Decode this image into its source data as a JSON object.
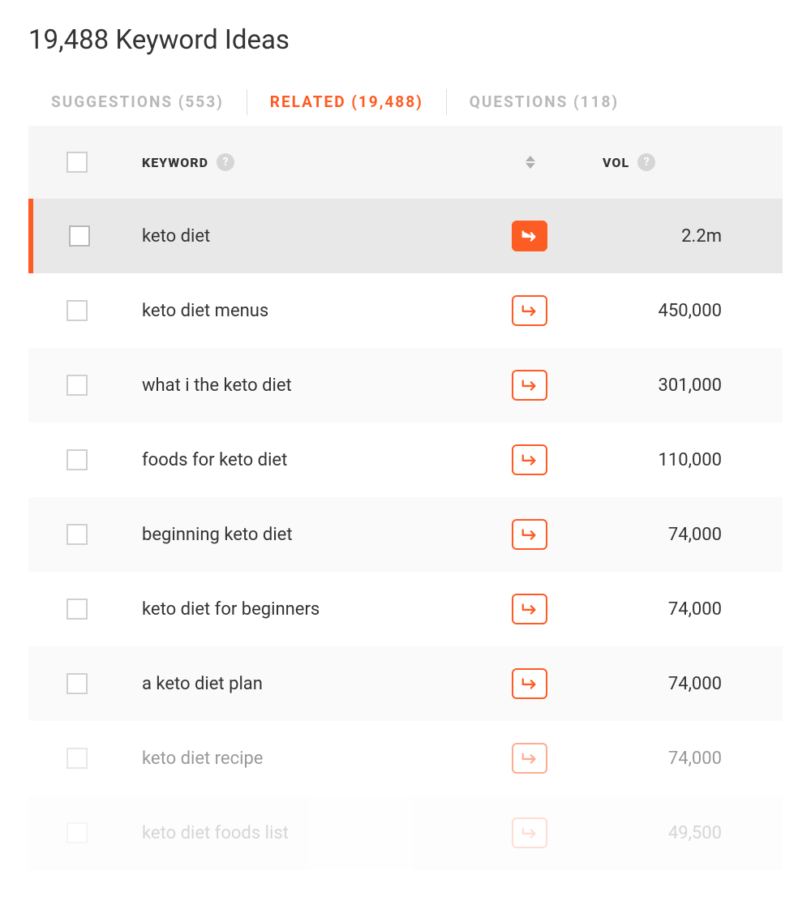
{
  "header": {
    "title": "19,488 Keyword Ideas"
  },
  "tabs": {
    "suggestions": "SUGGESTIONS (553)",
    "related": "RELATED (19,488)",
    "questions": "QUESTIONS (118)"
  },
  "columns": {
    "keyword": "KEYWORD",
    "vol": "VOL"
  },
  "rows": [
    {
      "keyword": "keto diet",
      "vol": "2.2m",
      "selected": true
    },
    {
      "keyword": "keto diet menus",
      "vol": "450,000",
      "selected": false
    },
    {
      "keyword": "what i the keto diet",
      "vol": "301,000",
      "selected": false
    },
    {
      "keyword": "foods for keto diet",
      "vol": "110,000",
      "selected": false
    },
    {
      "keyword": "beginning keto diet",
      "vol": "74,000",
      "selected": false
    },
    {
      "keyword": "keto diet for beginners",
      "vol": "74,000",
      "selected": false
    },
    {
      "keyword": "a keto diet plan",
      "vol": "74,000",
      "selected": false
    },
    {
      "keyword": "keto diet recipe",
      "vol": "74,000",
      "selected": false
    },
    {
      "keyword": "keto diet foods list",
      "vol": "49,500",
      "selected": false
    }
  ]
}
